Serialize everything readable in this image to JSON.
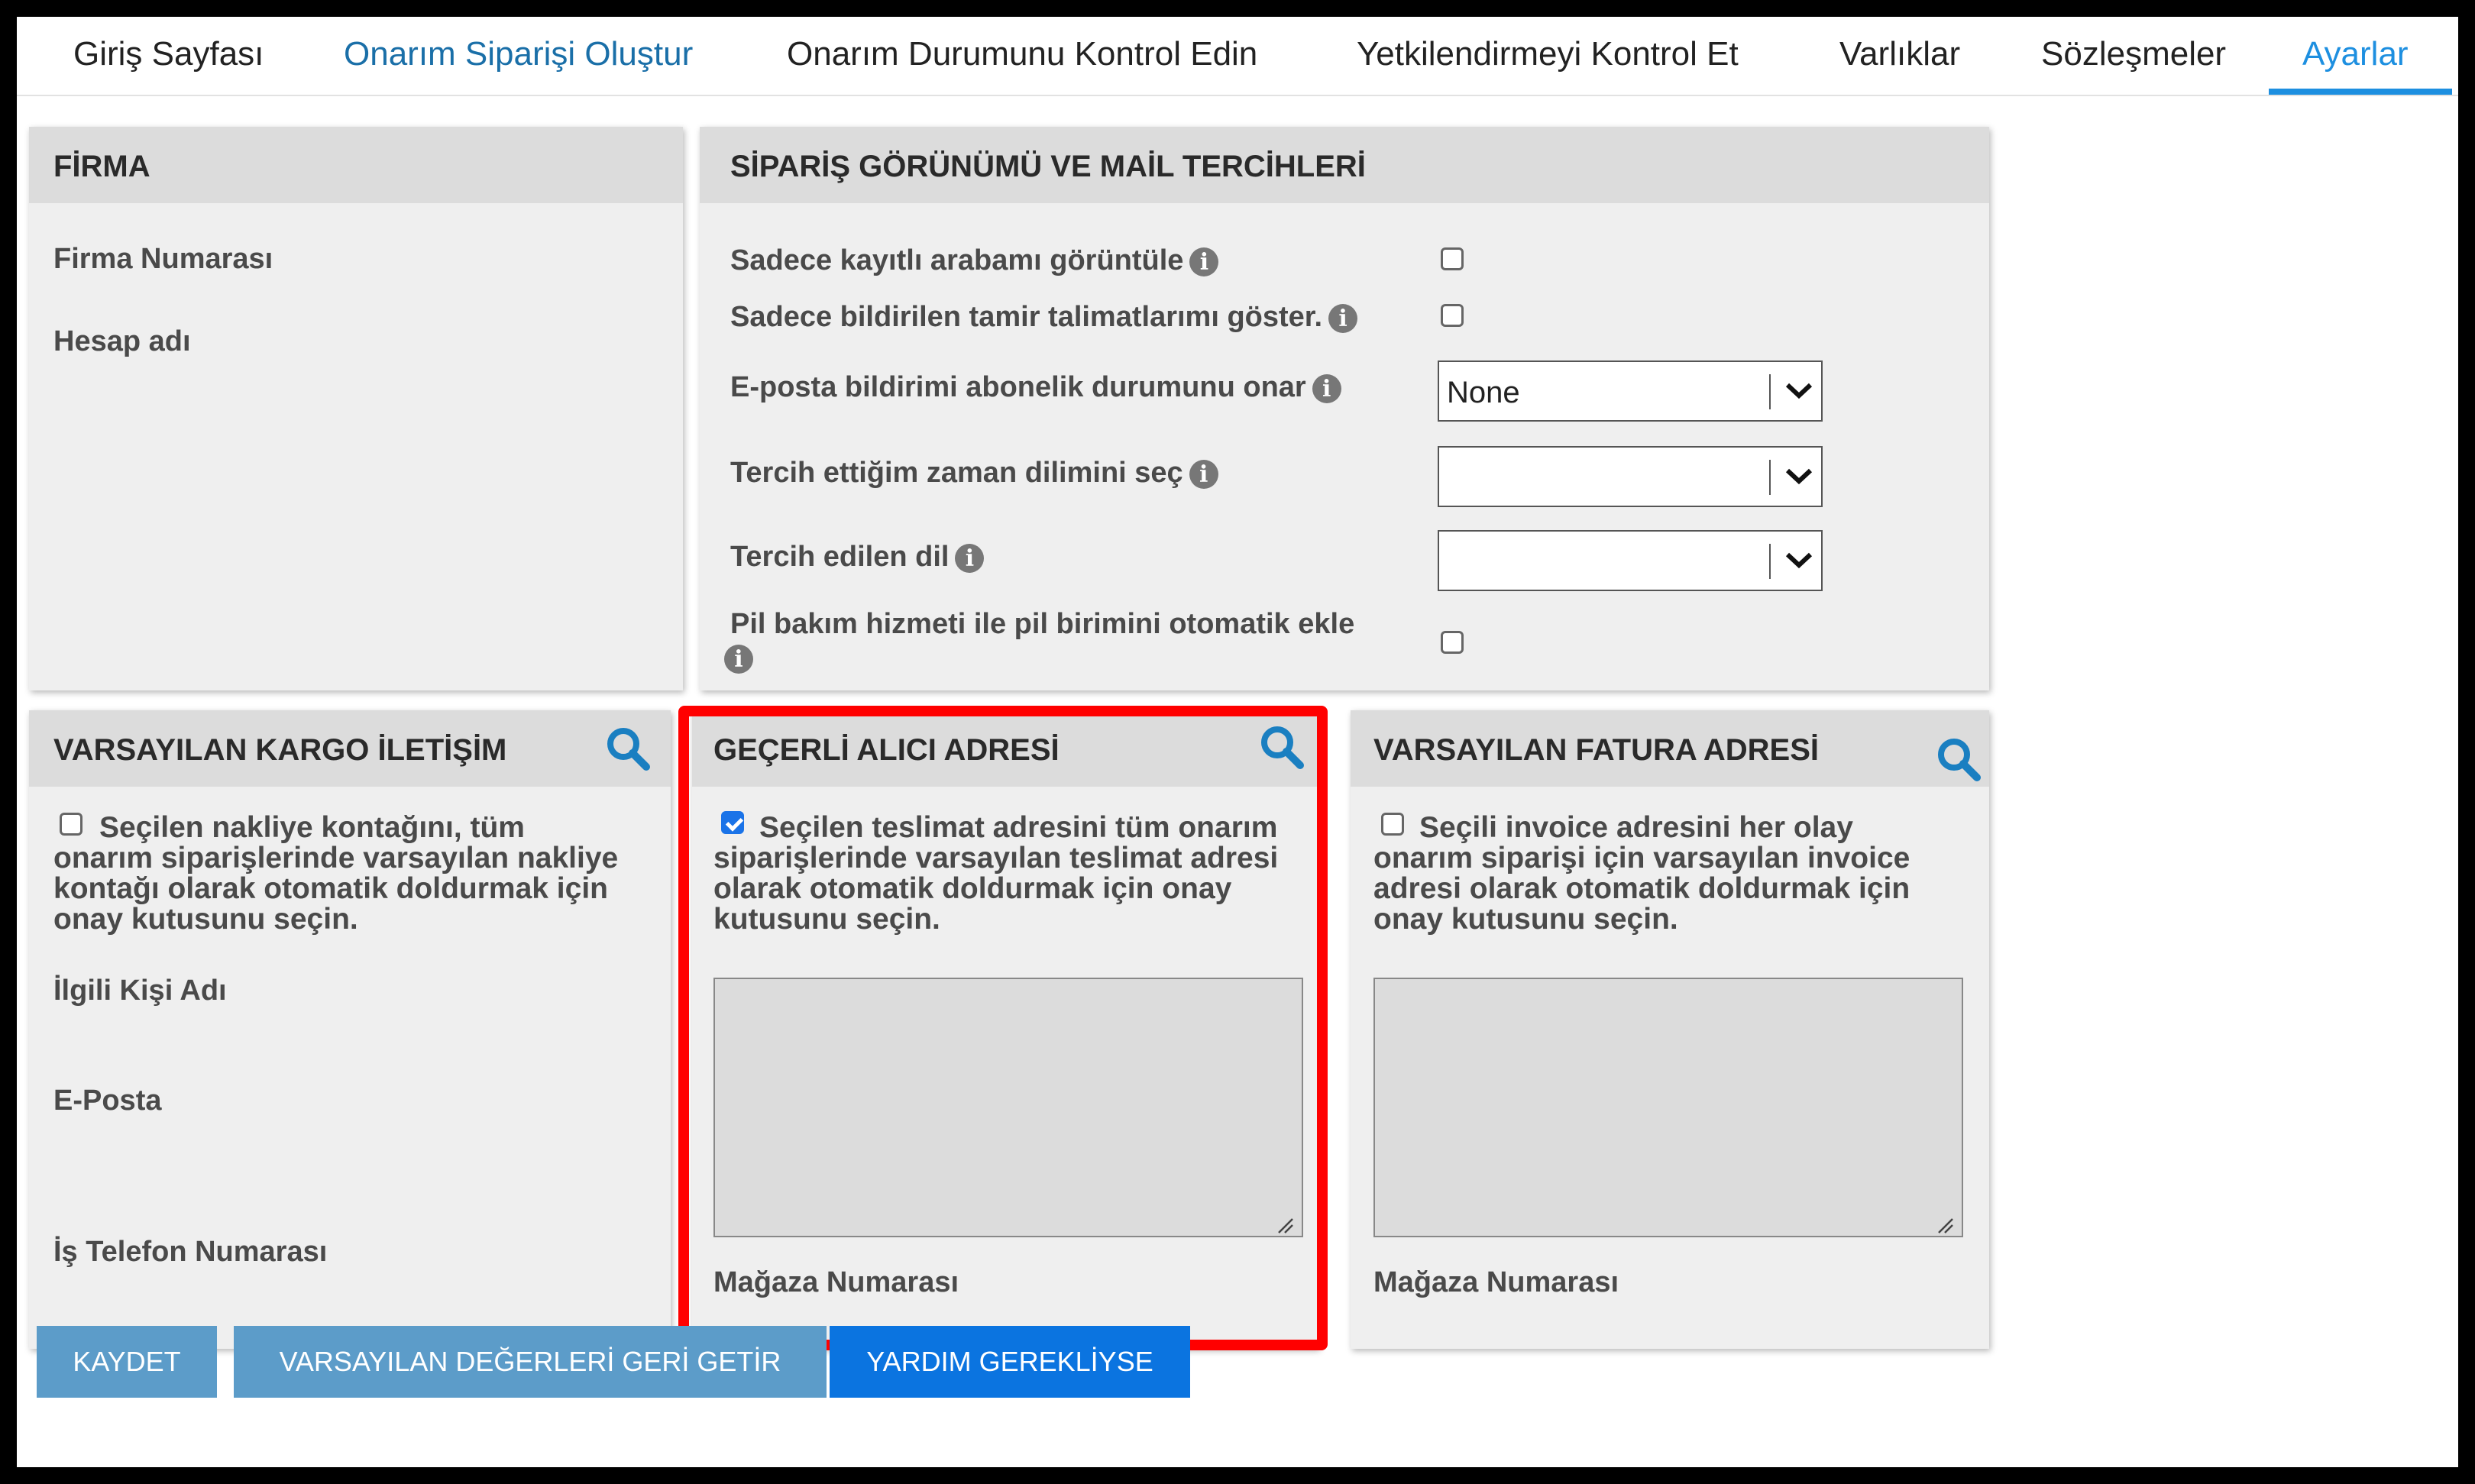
{
  "nav": {
    "tabs": [
      {
        "label": "Giriş Sayfası"
      },
      {
        "label": "Onarım Siparişi Oluştur"
      },
      {
        "label": "Onarım Durumunu Kontrol Edin"
      },
      {
        "label": "Yetkilendirmeyi Kontrol Et"
      },
      {
        "label": "Varlıklar"
      },
      {
        "label": "Sözleşmeler"
      },
      {
        "label": "Ayarlar"
      }
    ],
    "active_tab": "Ayarlar",
    "active_color": "#1d8fe0",
    "link_color": "#1a6fa8"
  },
  "firma": {
    "title": "FİRMA",
    "fields": [
      "Firma Numarası",
      "Hesap adı"
    ]
  },
  "preferences": {
    "title": "SİPARİŞ GÖRÜNÜMÜ VE MAİL TERCİHLERİ",
    "only_registered_car": {
      "label": "Sadece kayıtlı arabamı görüntüle",
      "checked": false
    },
    "only_reported_repairs": {
      "label": "Sadece bildirilen tamir talimatlarımı göster.",
      "checked": false
    },
    "email_subscription": {
      "label": "E-posta bildirimi abonelik durumunu onar",
      "value": "None"
    },
    "timezone": {
      "label": "Tercih ettiğim zaman dilimini seç",
      "value": ""
    },
    "language": {
      "label": "Tercih edilen dil",
      "value": ""
    },
    "battery_auto_add": {
      "label": "Pil bakım hizmeti ile pil birimini otomatik ekle",
      "checked": false
    },
    "info_glyph": "i"
  },
  "shipping_contact": {
    "title": "VARSAYILAN KARGO İLETİŞİM",
    "checkbox_checked": false,
    "description": [
      "Seçilen nakliye kontağını, tüm",
      "onarım siparişlerinde varsayılan nakliye",
      "kontağı olarak otomatik doldurmak için",
      "onay kutusunu seçin."
    ],
    "fields": [
      "İlgili Kişi Adı",
      "E-Posta",
      "İş Telefon Numarası"
    ]
  },
  "recipient_address": {
    "title": "GEÇERLİ ALICI ADRESİ",
    "checkbox_checked": true,
    "description": [
      "Seçilen teslimat adresini tüm onarım",
      "siparişlerinde varsayılan teslimat adresi",
      "olarak otomatik doldurmak için onay",
      "kutusunu seçin."
    ],
    "address_value": "",
    "store_label": "Mağaza Numarası"
  },
  "billing_address": {
    "title": "VARSAYILAN FATURA ADRESİ",
    "checkbox_checked": false,
    "description": [
      "Seçili invoice adresini her olay",
      "onarım siparişi için varsayılan invoice",
      "adresi olarak otomatik doldurmak için",
      "onay kutusunu seçin."
    ],
    "address_value": "",
    "store_label": "Mağaza Numarası"
  },
  "actions": {
    "save": "KAYDET",
    "restore_defaults": "VARSAYILAN DEĞERLERİ GERİ GETİR",
    "help": "YARDIM GEREKLİYSE"
  },
  "colors": {
    "highlight": "#ff0000",
    "search_icon": "#1a7fc1",
    "button_muted": "#5c9cc9",
    "button_primary": "#0b74e0"
  }
}
